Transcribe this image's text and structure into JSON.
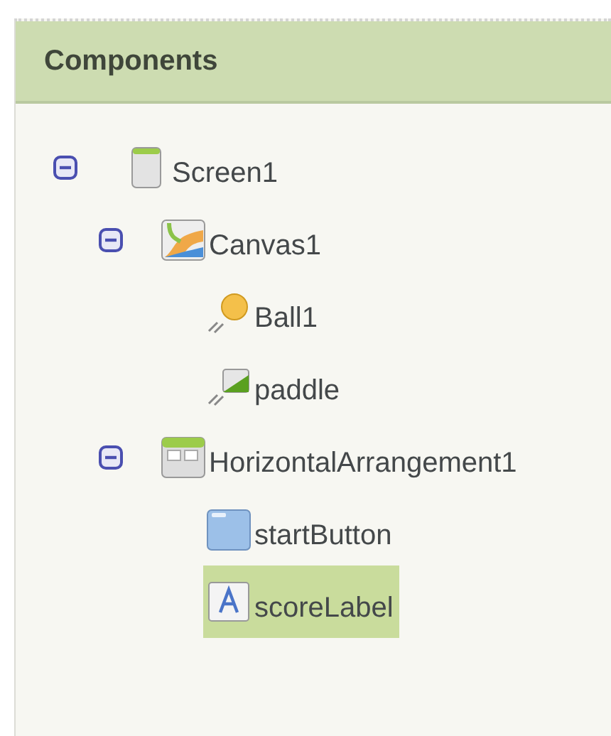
{
  "panel": {
    "title": "Components"
  },
  "tree": [
    {
      "label": "Screen1",
      "kind": "screen",
      "expanded": true,
      "selected": false,
      "children": [
        {
          "label": "Canvas1",
          "kind": "canvas",
          "expanded": true,
          "selected": false,
          "children": [
            {
              "label": "Ball1",
              "kind": "ball",
              "selected": false
            },
            {
              "label": "paddle",
              "kind": "sprite",
              "selected": false
            }
          ]
        },
        {
          "label": "HorizontalArrangement1",
          "kind": "arrangement",
          "expanded": true,
          "selected": false,
          "children": [
            {
              "label": "startButton",
              "kind": "button",
              "selected": false
            },
            {
              "label": "scoreLabel",
              "kind": "label",
              "selected": true
            }
          ]
        }
      ]
    }
  ]
}
